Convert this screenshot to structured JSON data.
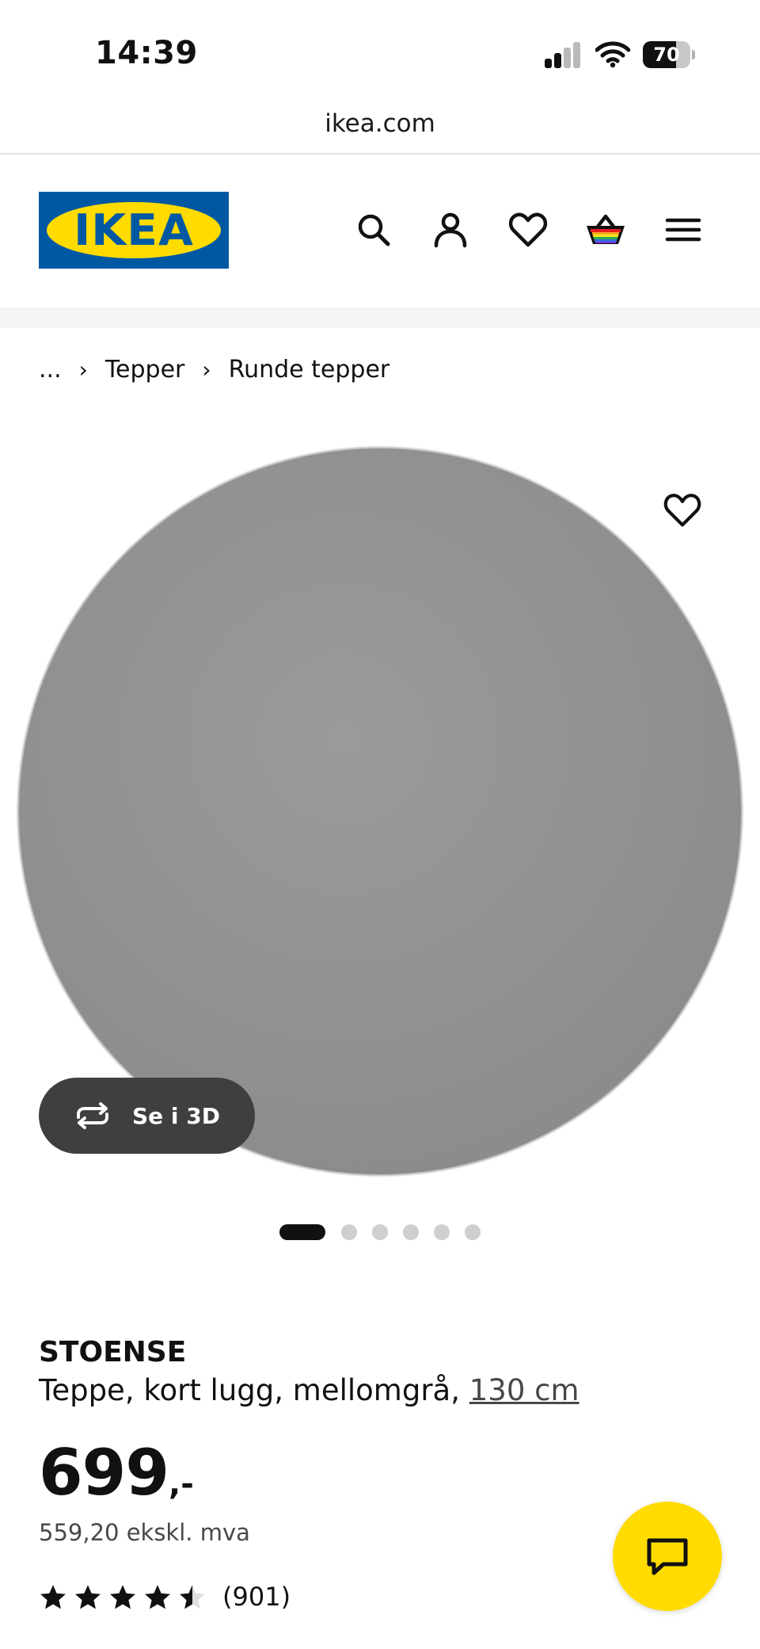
{
  "status_bar": {
    "time": "14:39",
    "battery": "70",
    "battery_level": 0.7
  },
  "browser": {
    "url": "ikea.com"
  },
  "header": {
    "logo_text": "IKEA",
    "icons": [
      "search-icon",
      "account-icon",
      "favorites-icon",
      "cart-icon",
      "menu-icon"
    ]
  },
  "breadcrumb": {
    "ellipsis": "...",
    "items": [
      "Tepper",
      "Runde tepper"
    ]
  },
  "gallery": {
    "view_3d_label": "Se i 3D",
    "slides": 6,
    "active_slide": 1
  },
  "product": {
    "name": "STOENSE",
    "description": "Teppe, kort lugg, mellomgrå,",
    "size_link": "130 cm",
    "price": "699",
    "price_suffix": ",-",
    "price_ex_vat": "559,20 ekskl. mva",
    "rating": 4.5,
    "rating_max": 5,
    "review_count": "(901)"
  },
  "colors": {
    "ikea_blue": "#0058A3",
    "ikea_yellow": "#FFDB00"
  }
}
